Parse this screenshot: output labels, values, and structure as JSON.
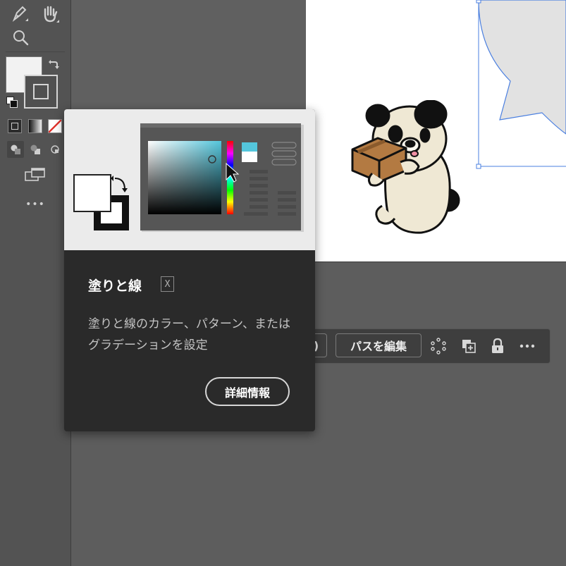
{
  "toolbar": {
    "tools": [
      {
        "name": "pen-tool",
        "icon": "pen-icon"
      },
      {
        "name": "hand-tool",
        "icon": "hand-icon"
      },
      {
        "name": "zoom-tool",
        "icon": "magnifier-icon"
      }
    ],
    "fill_color": "#f2f2f2",
    "stroke_color": "#3c3c3c",
    "more_label": "•••"
  },
  "popover": {
    "title": "塗りと線",
    "shortcut_key": "X",
    "description": "塗りと線のカラー、パターン、またはグラデーションを設定",
    "learn_more_label": "詳細情報"
  },
  "context_bar": {
    "partial_button_label": ")",
    "edit_path_label": "パスを編集",
    "icons": [
      "transform-points-icon",
      "duplicate-icon",
      "lock-icon",
      "more-icon"
    ]
  },
  "colors": {
    "app_bg": "#5d5d5d",
    "toolbar_bg": "#535353",
    "popover_bg": "#2a2a2a",
    "selection_blue": "#4a7fe0",
    "accent_cyan": "#54c6dc"
  }
}
